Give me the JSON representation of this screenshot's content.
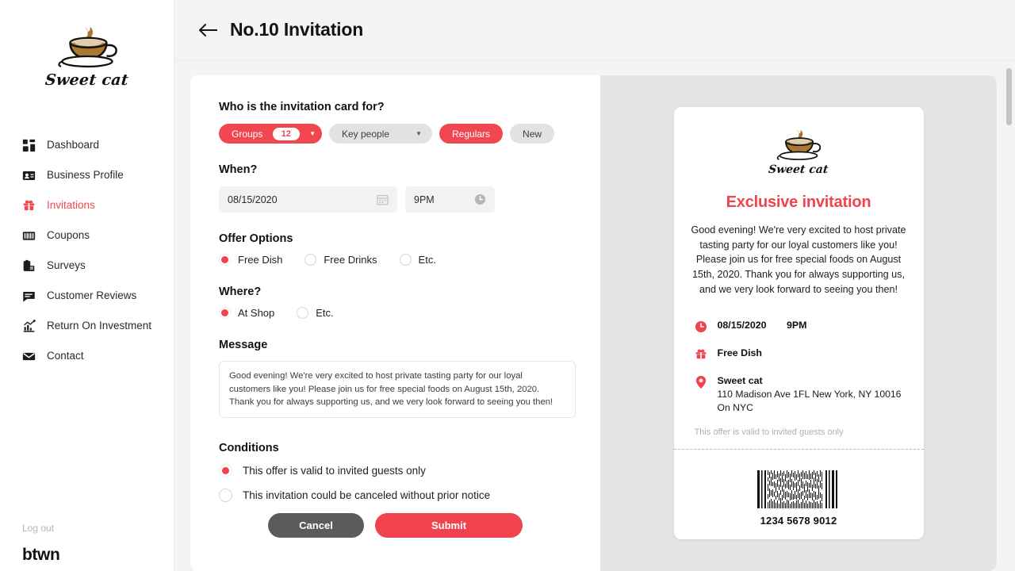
{
  "sidebar": {
    "logo": {
      "icon": "coffee-cup-cat-logo",
      "wordmark": "Sweet cat"
    },
    "items": [
      {
        "label": "Dashboard",
        "icon": "dashboard-icon",
        "active": false
      },
      {
        "label": "Business Profile",
        "icon": "id-card-icon",
        "active": false
      },
      {
        "label": "Invitations",
        "icon": "gift-icon",
        "active": true
      },
      {
        "label": "Coupons",
        "icon": "coupon-icon",
        "active": false
      },
      {
        "label": "Surveys",
        "icon": "clipboard-icon",
        "active": false
      },
      {
        "label": "Customer Reviews",
        "icon": "chat-bubble-icon",
        "active": false
      },
      {
        "label": "Return On Investment",
        "icon": "chart-up-icon",
        "active": false
      },
      {
        "label": "Contact",
        "icon": "envelope-icon",
        "active": false
      }
    ],
    "logout_label": "Log out",
    "brandmark": "btwn"
  },
  "header": {
    "back_icon": "back-arrow-icon",
    "title": "No.10 Invitation"
  },
  "form": {
    "audience": {
      "label": "Who is the invitation card for?",
      "options": [
        {
          "label": "Groups",
          "badge": "12",
          "style": "red",
          "has_caret": true
        },
        {
          "label": "Key people",
          "style": "grey",
          "has_caret": true
        },
        {
          "label": "Regulars",
          "style": "red",
          "has_caret": false
        },
        {
          "label": "New",
          "style": "grey",
          "has_caret": false
        }
      ]
    },
    "when": {
      "label": "When?",
      "date_value": "08/15/2020",
      "date_icon": "calendar-icon",
      "time_value": "9PM",
      "time_icon": "clock-icon"
    },
    "offer": {
      "label": "Offer Options",
      "options": [
        {
          "label": "Free Dish",
          "selected": true
        },
        {
          "label": "Free Drinks",
          "selected": false
        },
        {
          "label": "Etc.",
          "selected": false
        }
      ]
    },
    "where": {
      "label": "Where?",
      "options": [
        {
          "label": "At Shop",
          "selected": true
        },
        {
          "label": "Etc.",
          "selected": false
        }
      ]
    },
    "message": {
      "label": "Message",
      "value": "Good evening! We're very excited to host private tasting party for our loyal customers like you! Please join us for free special foods on August 15th, 2020. Thank you for always supporting us, and we very look forward to seeing you then!"
    },
    "conditions": {
      "label": "Conditions",
      "options": [
        {
          "label": "This offer is valid to invited guests only",
          "selected": true
        },
        {
          "label": "This invitation could be canceled without prior notice",
          "selected": false
        }
      ]
    },
    "cancel_label": "Cancel",
    "submit_label": "Submit"
  },
  "preview": {
    "logo": {
      "icon": "coffee-cup-cat-logo",
      "wordmark": "Sweet cat"
    },
    "title": "Exclusive invitation",
    "message": "Good evening! We're very excited to host private tasting party for our loyal customers like you! Please join us for free special foods on August 15th, 2020. Thank you for always supporting us, and we very look forward to seeing you then!",
    "details": {
      "when_icon": "clock-icon",
      "when_date": "08/15/2020",
      "when_time": "9PM",
      "offer_icon": "gift-icon",
      "offer": "Free Dish",
      "place_icon": "location-pin-icon",
      "place_name": "Sweet cat",
      "place_address": "110 Madison Ave 1FL New York, NY 10016",
      "place_city": "On NYC"
    },
    "note": "This offer is valid to invited guests only",
    "barcode_icon": "barcode",
    "barcode_number": "1234 5678 9012"
  },
  "colors": {
    "accent_red": "#f0434d",
    "pill_grey": "#e2e2e4",
    "panel_grey": "#e5e5e5",
    "cancel_grey": "#5b5b5b"
  }
}
